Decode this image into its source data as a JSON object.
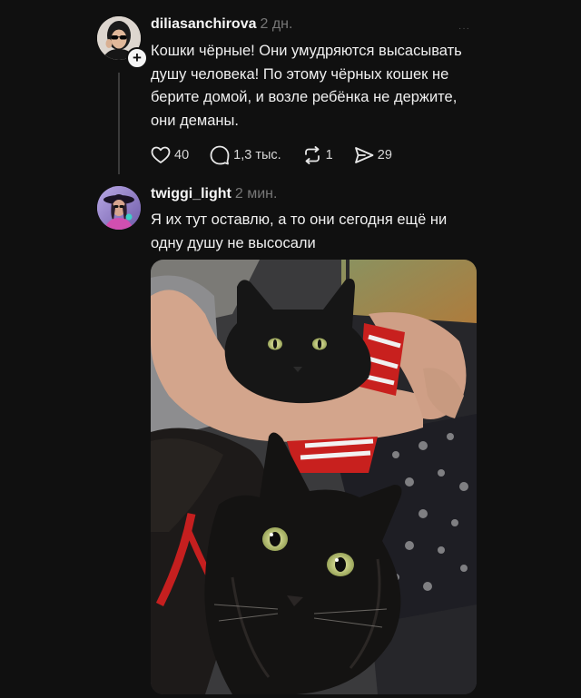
{
  "post1": {
    "username": "diliasanchirova",
    "time": "2 дн.",
    "text": "Кошки чёрные! Они умудряются высасывать душу человека! По этому чёрных кошек не берите домой, и возле ребёнка не держите, они деманы.",
    "actions": {
      "likes": "40",
      "replies": "1,3 тыс.",
      "reposts": "1",
      "shares": "29"
    },
    "follow_badge": "+"
  },
  "post2": {
    "username": "twiggi_light",
    "time": "2 мин.",
    "text": "Я их тут оставлю, а то они сегодня ещё ни одну душу не высосали",
    "photo_icon": "photo-two-black-cats"
  },
  "menu_icon": "more-dots-icon",
  "colors": {
    "background": "#101010",
    "text": "#f0f0f0",
    "muted": "#777777",
    "thread_line": "#3a3a3a"
  }
}
